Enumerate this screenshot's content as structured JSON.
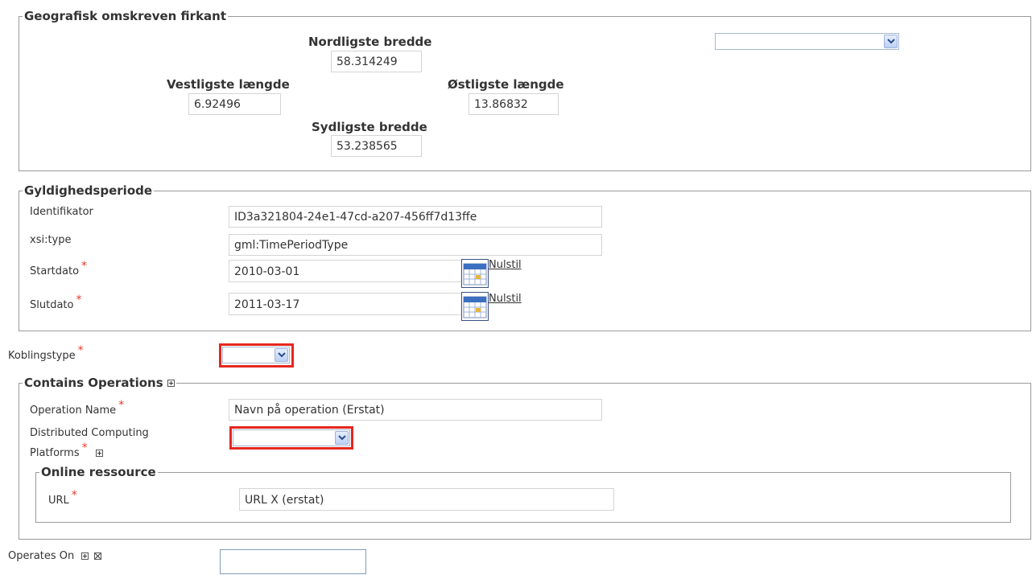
{
  "bbox_section": {
    "legend": "Geografisk omskreven firkant",
    "north": {
      "label": "Nordligste bredde",
      "value": "58.314249"
    },
    "west": {
      "label": "Vestligste længde",
      "value": "6.92496"
    },
    "east": {
      "label": "Østligste længde",
      "value": "13.86832"
    },
    "south": {
      "label": "Sydligste bredde",
      "value": "53.238565"
    },
    "select_value": ""
  },
  "validity_section": {
    "legend": "Gyldighedsperiode",
    "identifier": {
      "label": "Identifikator",
      "value": "ID3a321804-24e1-47cd-a207-456ff7d13ffe"
    },
    "xsi_type": {
      "label": "xsi:type",
      "value": "gml:TimePeriodType"
    },
    "start": {
      "label": "Startdato",
      "value": "2010-03-01",
      "reset": "Nulstil"
    },
    "end": {
      "label": "Slutdato",
      "value": "2011-03-17",
      "reset": "Nulstil"
    }
  },
  "coupling": {
    "label": "Koblingstype",
    "value": ""
  },
  "operations_section": {
    "legend": "Contains Operations",
    "operation_name": {
      "label": "Operation Name",
      "value": "Navn på operation (Erstat)"
    },
    "dcp": {
      "label_line1": "Distributed Computing",
      "label_line2": "Platforms",
      "value": ""
    },
    "online_resource": {
      "legend": "Online ressource",
      "url": {
        "label": "URL",
        "value": "URL X (erstat)"
      }
    }
  },
  "operates_on": {
    "label": "Operates On",
    "value": ""
  },
  "required_marker": "*",
  "colors": {
    "required": "#e53a2b",
    "highlight_border": "#e5271f",
    "border": "#9a9a9a"
  }
}
